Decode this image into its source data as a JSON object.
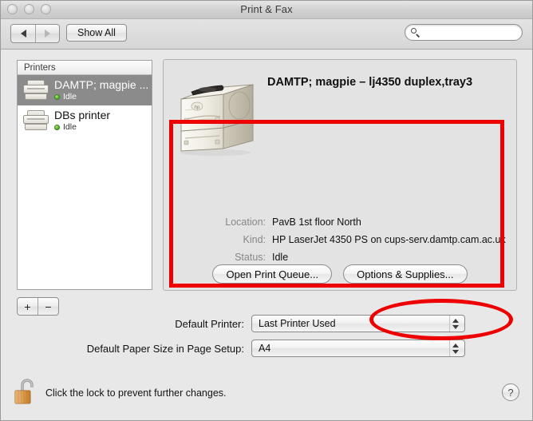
{
  "window": {
    "title": "Print & Fax"
  },
  "toolbar": {
    "back_icon": "back-arrow-icon",
    "forward_icon": "forward-arrow-icon",
    "show_all_label": "Show All",
    "search_value": "",
    "search_placeholder": "",
    "search_icon": "search-icon"
  },
  "sidebar": {
    "header": "Printers",
    "add_label": "+",
    "remove_label": "−",
    "items": [
      {
        "name": "DAMTP; magpie ...",
        "status": "Idle",
        "selected": true
      },
      {
        "name": "DBs printer",
        "status": "Idle",
        "selected": false
      }
    ]
  },
  "detail": {
    "title": "DAMTP; magpie – lj4350 duplex,tray3",
    "fields": [
      {
        "label": "Location:",
        "value": "PavB 1st floor North"
      },
      {
        "label": "Kind:",
        "value": "HP LaserJet 4350 PS on cups-serv.damtp.cam.ac.uk"
      },
      {
        "label": "Status:",
        "value": "Idle"
      }
    ],
    "open_queue_label": "Open Print Queue...",
    "options_supplies_label": "Options & Supplies..."
  },
  "defaults": {
    "printer_label": "Default Printer:",
    "printer_value": "Last Printer Used",
    "paper_label": "Default Paper Size in Page Setup:",
    "paper_value": "A4"
  },
  "footer": {
    "lock_text": "Click the lock to prevent further changes.",
    "lock_icon": "unlocked-padlock-icon",
    "help_label": "?"
  },
  "annotations": {
    "color": "#ee0000",
    "rectangle_target": "printer-detail-panel",
    "ellipse_target": "options-and-supplies-button"
  }
}
